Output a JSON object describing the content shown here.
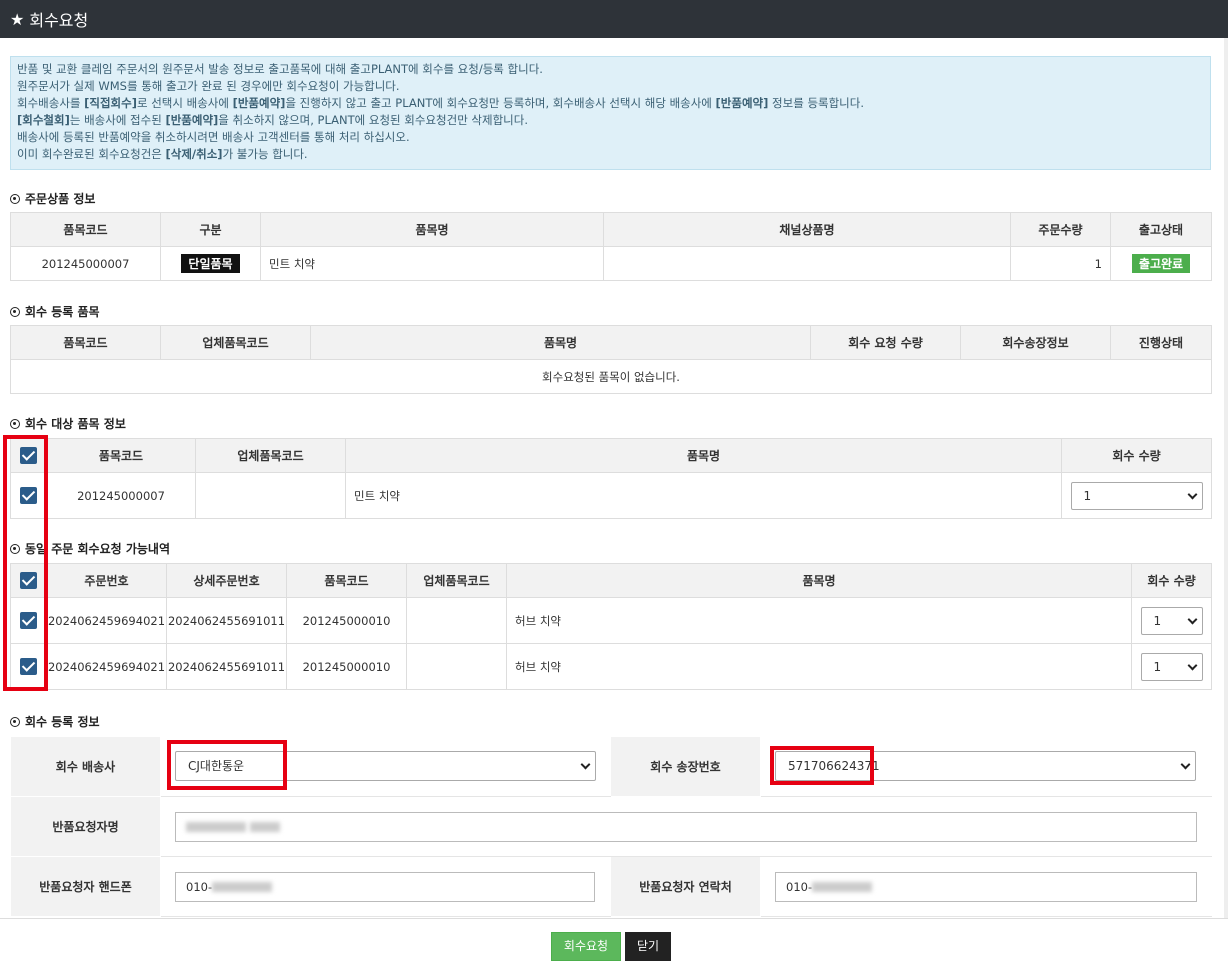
{
  "window": {
    "title": "회수요청"
  },
  "info": {
    "lines": [
      [
        {
          "t": "반품 및 교환 클레임 주문서의 원주문서 발송 정보로 출고품목에 대해 출고PLANT에 회수를 요청/등록 합니다."
        }
      ],
      [
        {
          "t": "원주문서가 실제 WMS를 통해 출고가 완료 된 경우에만 회수요청이 가능합니다."
        }
      ],
      [
        {
          "t": "회수배송사를 "
        },
        {
          "t": "[직접회수]",
          "b": true
        },
        {
          "t": "로 선택시 배송사에 "
        },
        {
          "t": "[반품예약]",
          "b": true
        },
        {
          "t": "을 진행하지 않고 출고 PLANT에 회수요청만 등록하며, 회수배송사 선택시 해당 배송사에 "
        },
        {
          "t": "[반품예약]",
          "b": true
        },
        {
          "t": " 정보를 등록합니다."
        }
      ],
      [
        {
          "t": "[회수철회]",
          "b": true
        },
        {
          "t": "는 배송사에 접수된 "
        },
        {
          "t": "[반품예약]",
          "b": true
        },
        {
          "t": "을 취소하지 않으며, PLANT에 요청된 회수요청건만 삭제합니다."
        }
      ],
      [
        {
          "t": "배송사에 등록된 반품예약을 취소하시려면 배송사 고객센터를 통해 처리 하십시오."
        }
      ],
      [
        {
          "t": "이미 회수완료된 회수요청건은 "
        },
        {
          "t": "[삭제/취소]",
          "b": true
        },
        {
          "t": "가 불가능 합니다."
        }
      ]
    ]
  },
  "sec_order": {
    "title": "주문상품 정보",
    "headers": [
      "품목코드",
      "구분",
      "품목명",
      "채널상품명",
      "주문수량",
      "출고상태"
    ],
    "row": {
      "code": "201245000007",
      "type": "단일품목",
      "name": "민트 치약",
      "channel_name": "",
      "qty": "1",
      "status": "출고완료"
    }
  },
  "sec_registered": {
    "title": "회수 등록 품목",
    "headers": [
      "품목코드",
      "업체품목코드",
      "품목명",
      "회수 요청 수량",
      "회수송장정보",
      "진행상태"
    ],
    "empty_text": "회수요청된 품목이 없습니다."
  },
  "sec_target": {
    "title": "회수 대상 품목 정보",
    "headers": [
      "품목코드",
      "업체품목코드",
      "품목명",
      "회수 수량"
    ],
    "row": {
      "code": "201245000007",
      "vendor_code": "",
      "name": "민트 치약",
      "qty": "1"
    }
  },
  "sec_same": {
    "title": "동일 주문 회수요청 가능내역",
    "headers": [
      "주문번호",
      "상세주문번호",
      "품목코드",
      "업체품목코드",
      "품목명",
      "회수 수량"
    ],
    "rows": [
      {
        "order_no": "2024062459694021",
        "detail_no": "2024062455691011",
        "code": "201245000010",
        "vendor_code": "",
        "name": "허브 치약",
        "qty": "1"
      },
      {
        "order_no": "2024062459694021",
        "detail_no": "2024062455691011",
        "code": "201245000010",
        "vendor_code": "",
        "name": "허브 치약",
        "qty": "1"
      }
    ]
  },
  "sec_form": {
    "title": "회수 등록 정보",
    "carrier_label": "회수 배송사",
    "carrier_value": "CJ대한통운",
    "invoice_label": "회수 송장번호",
    "invoice_value": "571706624371",
    "requester_label": "반품요청자명",
    "phone_label": "반품요청자 핸드폰",
    "phone_prefix": "010-",
    "contact_label": "반품요청자 연락처",
    "contact_prefix": "010-"
  },
  "footer": {
    "submit_label": "회수요청",
    "close_label": "닫기"
  },
  "colors": {
    "title_bg": "#2e3339",
    "info_bg": "#dff0f8",
    "checkbox": "#2b5c8a",
    "highlight": "#e60012",
    "green": "#5cb85c"
  }
}
